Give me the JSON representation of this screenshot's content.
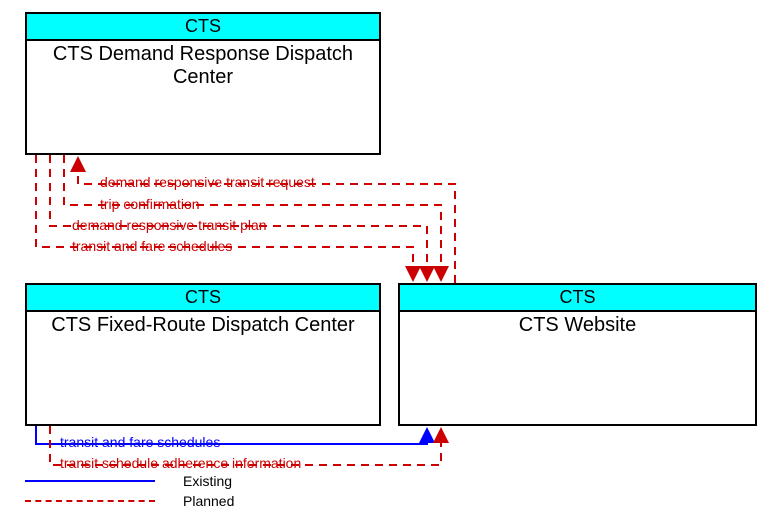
{
  "nodes": {
    "top": {
      "header": "CTS",
      "title": "CTS Demand Response Dispatch Center"
    },
    "left": {
      "header": "CTS",
      "title": "CTS Fixed-Route Dispatch Center"
    },
    "right": {
      "header": "CTS",
      "title": "CTS Website"
    }
  },
  "flows": {
    "f1": {
      "label": "demand responsive transit request",
      "type": "planned",
      "from": "right",
      "to": "top"
    },
    "f2": {
      "label": "trip confirmation",
      "type": "planned",
      "from": "top",
      "to": "right"
    },
    "f3": {
      "label": "demand responsive transit plan",
      "type": "planned",
      "from": "top",
      "to": "right"
    },
    "f4": {
      "label": "transit and fare schedules",
      "type": "planned",
      "from": "top",
      "to": "right"
    },
    "f5": {
      "label": "transit and fare schedules",
      "type": "existing",
      "from": "left",
      "to": "right"
    },
    "f6": {
      "label": "transit schedule adherence information",
      "type": "planned",
      "from": "left",
      "to": "right"
    }
  },
  "legend": {
    "existing": "Existing",
    "planned": "Planned"
  },
  "colors": {
    "existing": "#0000ff",
    "planned": "#cc0000",
    "node_header_bg": "#00ffff"
  }
}
